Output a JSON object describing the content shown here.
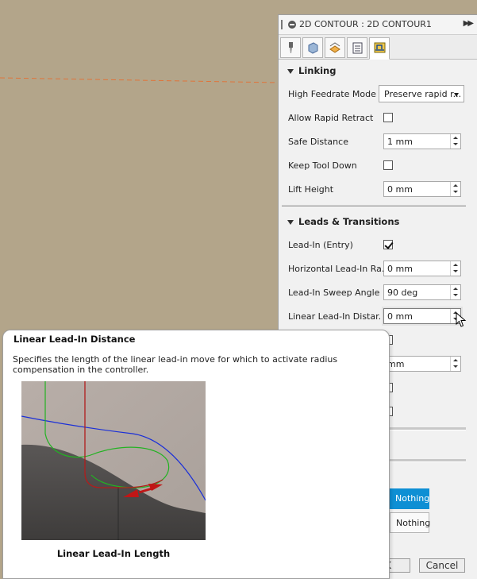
{
  "window": {
    "title": "2D CONTOUR : 2D CONTOUR1"
  },
  "tabs": [
    {
      "icon": "tool-icon"
    },
    {
      "icon": "geometry-icon"
    },
    {
      "icon": "heights-icon"
    },
    {
      "icon": "passes-icon"
    },
    {
      "icon": "linking-icon",
      "active": true
    }
  ],
  "linking": {
    "title": "Linking",
    "high_feedrate_label": "High Feedrate Mode",
    "high_feedrate_value": "Preserve rapid r...",
    "allow_rapid_retract_label": "Allow Rapid Retract",
    "allow_rapid_retract_checked": false,
    "safe_distance_label": "Safe Distance",
    "safe_distance_value": "1 mm",
    "keep_tool_down_label": "Keep Tool Down",
    "keep_tool_down_checked": false,
    "lift_height_label": "Lift Height",
    "lift_height_value": "0 mm"
  },
  "leads": {
    "title": "Leads & Transitions",
    "lead_in_label": "Lead-In (Entry)",
    "lead_in_checked": true,
    "horizontal_lead_in_label": "Horizontal Lead-In Ra...",
    "horizontal_lead_in_value": "0 mm",
    "sweep_angle_label": "Lead-In Sweep Angle",
    "sweep_angle_value": "90 deg",
    "linear_lead_in_label": "Linear Lead-In Distar...",
    "linear_lead_in_value": "0 mm",
    "hidden_field_value": "mm"
  },
  "selection": {
    "selected_label": "Nothing",
    "plain_label": "Nothing"
  },
  "footer": {
    "ok_label": "K",
    "cancel_label": "Cancel"
  },
  "tooltip": {
    "title": "Linear Lead-In Distance",
    "body": "Specifies the length of the linear lead-in move for which to activate radius compensation in the controller.",
    "caption": "Linear Lead-In Length"
  },
  "colors": {
    "viewport": "#b3a58a",
    "accent": "#0e8fd4",
    "toolpath_dash": "#e07a3a"
  }
}
